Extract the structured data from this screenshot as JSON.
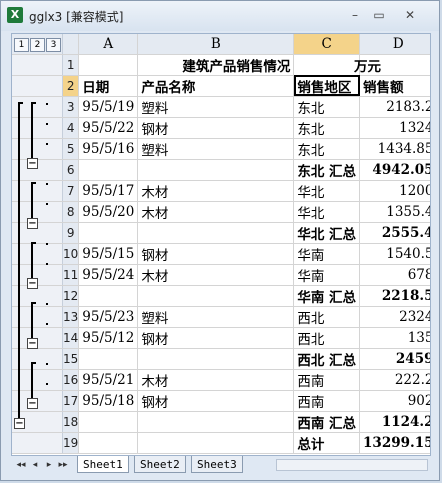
{
  "window": {
    "title": "gglx3  [兼容模式]",
    "min": "–",
    "restore": "▭",
    "close": "✕"
  },
  "outline_levels": [
    "1",
    "2",
    "3"
  ],
  "columns": [
    "A",
    "B",
    "C",
    "D"
  ],
  "rows": [
    {
      "n": "1",
      "a": "",
      "b": "建筑产品销售情况",
      "c": "",
      "d": "万元"
    },
    {
      "n": "2",
      "a": "日期",
      "b": "产品名称",
      "c": "销售地区",
      "d": "销售额"
    },
    {
      "n": "3",
      "a": "95/5/19",
      "b": "塑料",
      "c": "东北",
      "d": "2183.2"
    },
    {
      "n": "4",
      "a": "95/5/22",
      "b": "钢材",
      "c": "东北",
      "d": "1324"
    },
    {
      "n": "5",
      "a": "95/5/16",
      "b": "塑料",
      "c": "东北",
      "d": "1434.85"
    },
    {
      "n": "6",
      "a": "",
      "b": "",
      "c": "东北 汇总",
      "d": "4942.05"
    },
    {
      "n": "7",
      "a": "95/5/17",
      "b": "木材",
      "c": "华北",
      "d": "1200"
    },
    {
      "n": "8",
      "a": "95/5/20",
      "b": "木材",
      "c": "华北",
      "d": "1355.4"
    },
    {
      "n": "9",
      "a": "",
      "b": "",
      "c": "华北 汇总",
      "d": "2555.4"
    },
    {
      "n": "10",
      "a": "95/5/15",
      "b": "钢材",
      "c": "华南",
      "d": "1540.5"
    },
    {
      "n": "11",
      "a": "95/5/24",
      "b": "木材",
      "c": "华南",
      "d": "678"
    },
    {
      "n": "12",
      "a": "",
      "b": "",
      "c": "华南 汇总",
      "d": "2218.5"
    },
    {
      "n": "13",
      "a": "95/5/23",
      "b": "塑料",
      "c": "西北",
      "d": "2324"
    },
    {
      "n": "14",
      "a": "95/5/12",
      "b": "钢材",
      "c": "西北",
      "d": "135"
    },
    {
      "n": "15",
      "a": "",
      "b": "",
      "c": "西北 汇总",
      "d": "2459"
    },
    {
      "n": "16",
      "a": "95/5/21",
      "b": "木材",
      "c": "西南",
      "d": "222.2"
    },
    {
      "n": "17",
      "a": "95/5/18",
      "b": "钢材",
      "c": "西南",
      "d": "902"
    },
    {
      "n": "18",
      "a": "",
      "b": "",
      "c": "西南 汇总",
      "d": "1124.2"
    },
    {
      "n": "19",
      "a": "",
      "b": "",
      "c": "总计",
      "d": "13299.15"
    }
  ],
  "tabs": [
    "Sheet1",
    "Sheet2",
    "Sheet3"
  ],
  "tab_nav": [
    "◂◂",
    "◂",
    "▸",
    "▸▸"
  ]
}
